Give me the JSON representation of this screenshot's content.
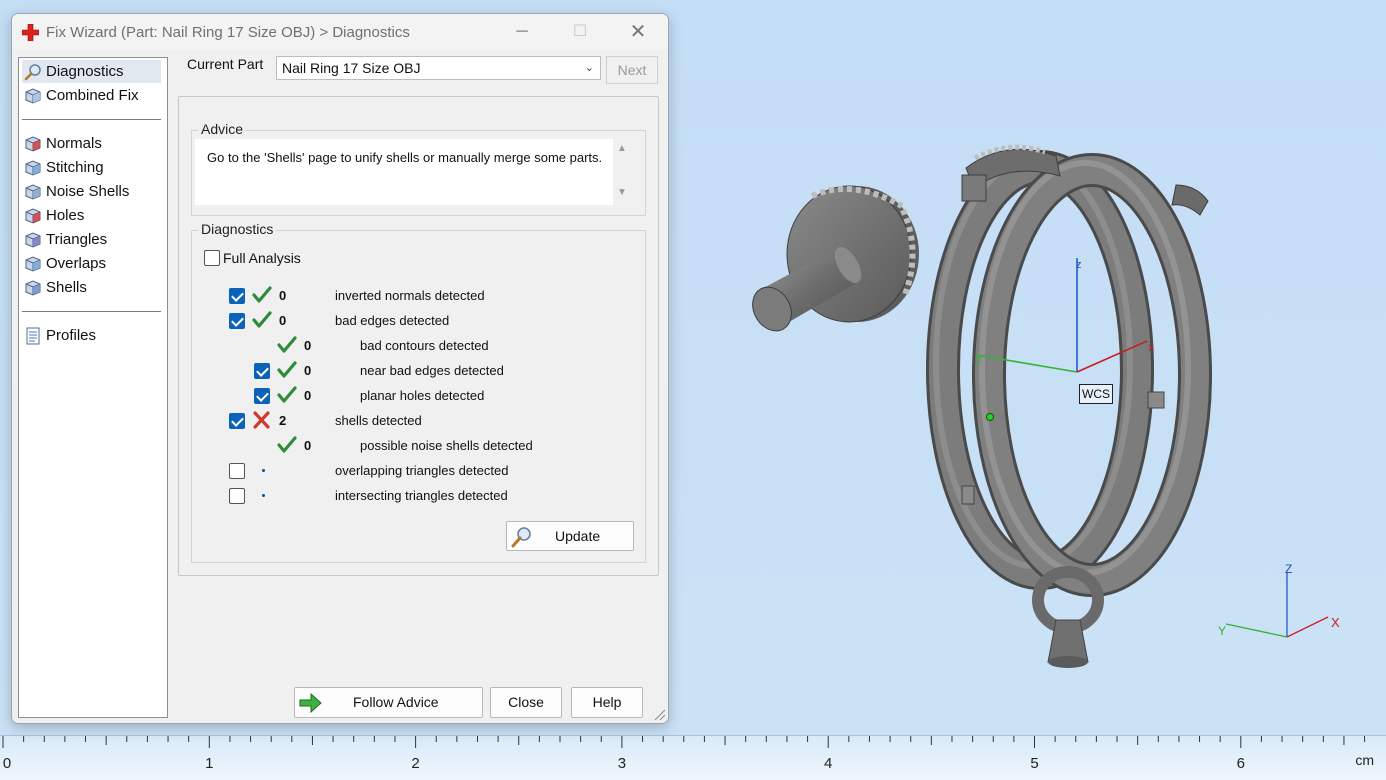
{
  "window": {
    "title": "Fix Wizard (Part: Nail Ring 17 Size OBJ) > Diagnostics",
    "minimize": "─",
    "maximize": "☐",
    "close": "✕"
  },
  "nav": {
    "items": [
      {
        "label": "Diagnostics",
        "icon": "magnifier-icon",
        "selected": true
      },
      {
        "label": "Combined Fix",
        "icon": "cube-stack-icon"
      },
      {
        "label": "Normals",
        "icon": "normals-cube-icon"
      },
      {
        "label": "Stitching",
        "icon": "stitching-cube-icon"
      },
      {
        "label": "Noise Shells",
        "icon": "noise-shells-icon"
      },
      {
        "label": "Holes",
        "icon": "holes-cube-icon"
      },
      {
        "label": "Triangles",
        "icon": "triangles-cube-icon"
      },
      {
        "label": "Overlaps",
        "icon": "overlaps-cube-icon"
      },
      {
        "label": "Shells",
        "icon": "shells-cube-icon"
      },
      {
        "label": "Profiles",
        "icon": "document-icon"
      }
    ]
  },
  "header": {
    "current_part_label": "Current Part",
    "current_part_value": "Nail Ring 17 Size OBJ",
    "next_label": "Next"
  },
  "advice": {
    "title": "Advice",
    "text": "Go to the 'Shells' page to unify shells or manually merge some parts."
  },
  "diagnostics": {
    "title": "Diagnostics",
    "full_analysis_label": "Full Analysis",
    "rows": [
      {
        "checkbox": "checked",
        "status": "ok",
        "count": "0",
        "label": "inverted normals detected",
        "indent": 0
      },
      {
        "checkbox": "checked",
        "status": "ok",
        "count": "0",
        "label": "bad edges detected",
        "indent": 0
      },
      {
        "checkbox": "none",
        "status": "ok",
        "count": "0",
        "label": "bad contours detected",
        "indent": 1
      },
      {
        "checkbox": "checked",
        "status": "ok",
        "count": "0",
        "label": "near bad edges detected",
        "indent": 1
      },
      {
        "checkbox": "checked",
        "status": "ok",
        "count": "0",
        "label": "planar holes detected",
        "indent": 1
      },
      {
        "checkbox": "checked",
        "status": "error",
        "count": "2",
        "label": "shells detected",
        "indent": 0
      },
      {
        "checkbox": "none",
        "status": "ok",
        "count": "0",
        "label": "possible noise shells detected",
        "indent": 1
      },
      {
        "checkbox": "unchecked",
        "status": "dot",
        "count": "",
        "label": "overlapping triangles detected",
        "indent": 0
      },
      {
        "checkbox": "unchecked",
        "status": "dot",
        "count": "",
        "label": "intersecting triangles detected",
        "indent": 0
      }
    ],
    "update_label": "Update"
  },
  "buttons": {
    "follow_advice": "Follow Advice",
    "close": "Close",
    "help": "Help"
  },
  "viewport": {
    "wcs_label": "WCS",
    "axis_x": "X",
    "axis_y": "Y",
    "axis_z": "Z",
    "small_axis_x": "x",
    "small_axis_y": "y",
    "small_axis_z": "z"
  },
  "ruler": {
    "numbers": [
      "0",
      "1",
      "2",
      "3",
      "4",
      "5",
      "6"
    ],
    "unit": "cm"
  },
  "colors": {
    "accent": "#0a63b8",
    "ok_check": "#2e8b3a",
    "error_x": "#d0392b",
    "model_gray": "#7d7d7d"
  }
}
